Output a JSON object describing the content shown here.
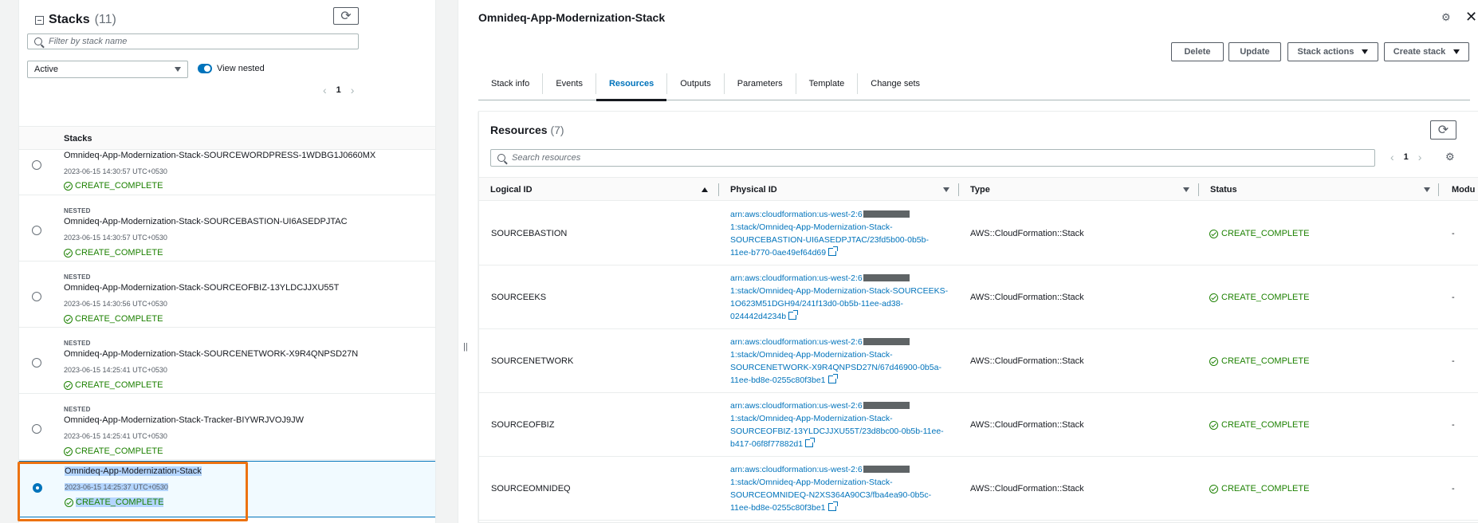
{
  "left_panel": {
    "title": "Stacks",
    "count": "(11)",
    "filter_placeholder": "Filter by stack name",
    "status_filter": "Active",
    "view_nested_label": "View nested",
    "page": "1",
    "column_header": "Stacks",
    "stacks": [
      {
        "nested": "",
        "name": "Omnideq-App-Modernization-Stack-SOURCEWORDPRESS-1WDBG1J0660MX",
        "timestamp": "2023-06-15 14:30:57 UTC+0530",
        "status": "CREATE_COMPLETE"
      },
      {
        "nested": "NESTED",
        "name": "Omnideq-App-Modernization-Stack-SOURCEBASTION-UI6ASEDPJTAC",
        "timestamp": "2023-06-15 14:30:57 UTC+0530",
        "status": "CREATE_COMPLETE"
      },
      {
        "nested": "NESTED",
        "name": "Omnideq-App-Modernization-Stack-SOURCEOFBIZ-13YLDCJJXU55T",
        "timestamp": "2023-06-15 14:30:56 UTC+0530",
        "status": "CREATE_COMPLETE"
      },
      {
        "nested": "NESTED",
        "name": "Omnideq-App-Modernization-Stack-SOURCENETWORK-X9R4QNPSD27N",
        "timestamp": "2023-06-15 14:25:41 UTC+0530",
        "status": "CREATE_COMPLETE"
      },
      {
        "nested": "NESTED",
        "name": "Omnideq-App-Modernization-Stack-Tracker-BIYWRJVOJ9JW",
        "timestamp": "2023-06-15 14:25:41 UTC+0530",
        "status": "CREATE_COMPLETE"
      },
      {
        "nested": "",
        "name": "Omnideq-App-Modernization-Stack",
        "timestamp": "2023-06-15 14:25:37 UTC+0530",
        "status": "CREATE_COMPLETE"
      }
    ]
  },
  "splitter_glyph": "||",
  "right_panel": {
    "title": "Omnideq-App-Modernization-Stack",
    "buttons": {
      "delete": "Delete",
      "update": "Update",
      "stack_actions": "Stack actions",
      "create_stack": "Create stack"
    },
    "tabs": [
      "Stack info",
      "Events",
      "Resources",
      "Outputs",
      "Parameters",
      "Template",
      "Change sets"
    ],
    "active_tab": "Resources",
    "resources": {
      "title": "Resources",
      "count": "(7)",
      "search_placeholder": "Search resources",
      "page": "1",
      "columns": [
        "Logical ID",
        "Physical ID",
        "Type",
        "Status",
        "Modu"
      ],
      "rows": [
        {
          "logical_id": "SOURCEBASTION",
          "pid_prefix": "arn:aws:cloudformation:us-west-2:6",
          "pid_suffix": "1:stack/Omnideq-App-Modernization-Stack-SOURCEBASTION-UI6ASEDPJTAC/23fd5b00-0b5b-11ee-b770-0ae49ef64d69",
          "type": "AWS::CloudFormation::Stack",
          "status": "CREATE_COMPLETE",
          "module": "-"
        },
        {
          "logical_id": "SOURCEEKS",
          "pid_prefix": "arn:aws:cloudformation:us-west-2:6",
          "pid_suffix": "1:stack/Omnideq-App-Modernization-Stack-SOURCEEKS-1O623M51DGH94/241f13d0-0b5b-11ee-ad38-024442d4234b",
          "type": "AWS::CloudFormation::Stack",
          "status": "CREATE_COMPLETE",
          "module": "-"
        },
        {
          "logical_id": "SOURCENETWORK",
          "pid_prefix": "arn:aws:cloudformation:us-west-2:6",
          "pid_suffix": "1:stack/Omnideq-App-Modernization-Stack-SOURCENETWORK-X9R4QNPSD27N/67d46900-0b5a-11ee-bd8e-0255c80f3be1",
          "type": "AWS::CloudFormation::Stack",
          "status": "CREATE_COMPLETE",
          "module": "-"
        },
        {
          "logical_id": "SOURCEOFBIZ",
          "pid_prefix": "arn:aws:cloudformation:us-west-2:6",
          "pid_suffix": "1:stack/Omnideq-App-Modernization-Stack-SOURCEOFBIZ-13YLDCJJXU55T/23d8bc00-0b5b-11ee-b417-06f8f77882d1",
          "type": "AWS::CloudFormation::Stack",
          "status": "CREATE_COMPLETE",
          "module": "-"
        },
        {
          "logical_id": "SOURCEOMNIDEQ",
          "pid_prefix": "arn:aws:cloudformation:us-west-2:6",
          "pid_suffix": "1:stack/Omnideq-App-Modernization-Stack-SOURCEOMNIDEQ-N2XS364A90C3/fba4ea90-0b5c-11ee-bd8e-0255c80f3be1",
          "type": "AWS::CloudFormation::Stack",
          "status": "CREATE_COMPLETE",
          "module": "-"
        }
      ]
    }
  },
  "colors": {
    "link": "#0073bb",
    "success": "#1d8102",
    "highlight_border": "#ec7211",
    "selection_bg": "#f1faff"
  },
  "icons": {
    "refresh": "refresh-icon",
    "search": "search-icon",
    "settings": "gear-icon",
    "close": "close-icon",
    "success": "check-circle-icon",
    "external": "external-link-icon"
  }
}
